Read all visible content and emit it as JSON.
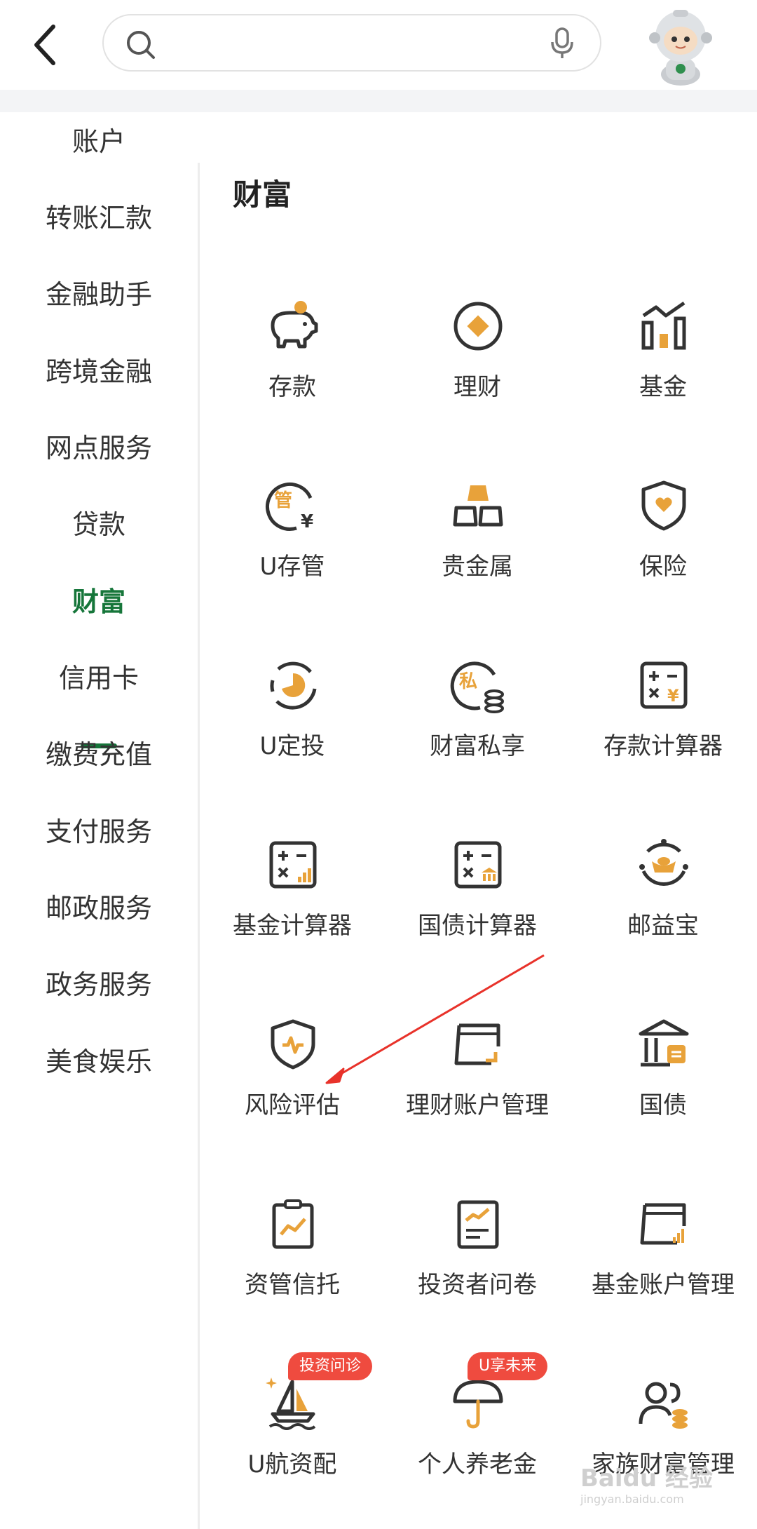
{
  "header": {
    "search_placeholder": ""
  },
  "sidebar": {
    "items": [
      {
        "label": "账户"
      },
      {
        "label": "转账汇款"
      },
      {
        "label": "金融助手"
      },
      {
        "label": "跨境金融"
      },
      {
        "label": "网点服务"
      },
      {
        "label": "贷款"
      },
      {
        "label": "财富",
        "active": true
      },
      {
        "label": "信用卡"
      },
      {
        "label": "缴费充值"
      },
      {
        "label": "支付服务"
      },
      {
        "label": "邮政服务"
      },
      {
        "label": "政务服务"
      },
      {
        "label": "美食娱乐"
      }
    ]
  },
  "main": {
    "title": "财富",
    "tiles": [
      {
        "label": "存款",
        "icon": "piggy-bank-icon"
      },
      {
        "label": "理财",
        "icon": "diamond-coin-icon"
      },
      {
        "label": "基金",
        "icon": "bar-chart-icon"
      },
      {
        "label": "U存管",
        "icon": "custody-icon"
      },
      {
        "label": "贵金属",
        "icon": "gold-bars-icon"
      },
      {
        "label": "保险",
        "icon": "shield-heart-icon"
      },
      {
        "label": "U定投",
        "icon": "pie-cycle-icon"
      },
      {
        "label": "财富私享",
        "icon": "private-wealth-icon"
      },
      {
        "label": "存款计算器",
        "icon": "deposit-calculator-icon"
      },
      {
        "label": "基金计算器",
        "icon": "fund-calculator-icon"
      },
      {
        "label": "国债计算器",
        "icon": "bond-calculator-icon"
      },
      {
        "label": "邮益宝",
        "icon": "gold-ingot-cycle-icon"
      },
      {
        "label": "风险评估",
        "icon": "shield-pulse-icon"
      },
      {
        "label": "理财账户管理",
        "icon": "wallet-card-icon"
      },
      {
        "label": "国债",
        "icon": "bank-building-icon"
      },
      {
        "label": "资管信托",
        "icon": "clipboard-chart-icon"
      },
      {
        "label": "投资者问卷",
        "icon": "questionnaire-icon"
      },
      {
        "label": "基金账户管理",
        "icon": "fund-account-icon"
      },
      {
        "label": "U航资配",
        "icon": "sailboat-icon",
        "badge": "投资问诊"
      },
      {
        "label": "个人养老金",
        "icon": "umbrella-icon",
        "badge": "U享未来"
      },
      {
        "label": "家族财富管理",
        "icon": "family-wealth-icon"
      }
    ]
  },
  "colors": {
    "accent_green": "#16763a",
    "icon_orange": "#e8a23a",
    "badge_red": "#ef4b3f"
  },
  "watermark": {
    "brand": "Baidu 经验",
    "url": "jingyan.baidu.com"
  }
}
